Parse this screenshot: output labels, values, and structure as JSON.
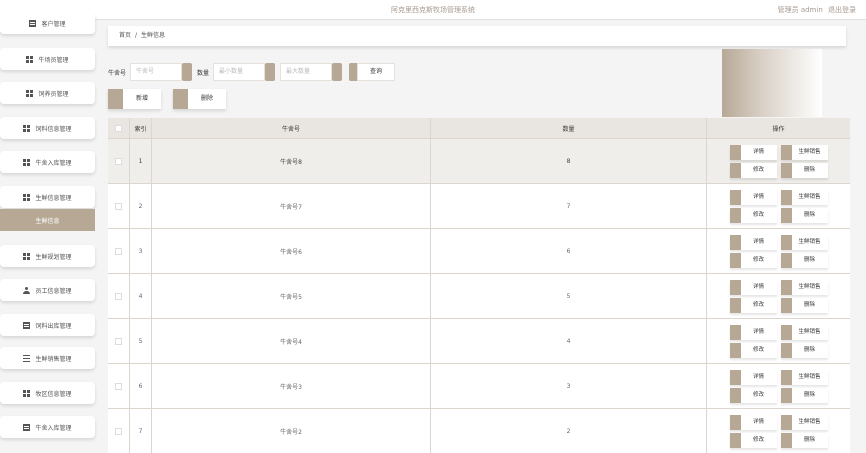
{
  "header": {
    "title": "阿克里西克斯牧场管理系统",
    "user_label": "管理员 admin",
    "logout_label": "退出登录"
  },
  "sidebar": {
    "items": [
      {
        "label": "客户管理",
        "icon": "doc-icon"
      },
      {
        "label": "牛场员管理",
        "icon": "grid-icon"
      },
      {
        "label": "饲养员管理",
        "icon": "grid-icon"
      },
      {
        "label": "饲料信息管理",
        "icon": "grid-icon"
      },
      {
        "label": "牛舍入库管理",
        "icon": "grid-icon"
      },
      {
        "label": "生鲜信息管理",
        "icon": "grid-icon"
      },
      {
        "label": "生鲜信息",
        "icon": "",
        "active": true
      },
      {
        "label": "生鲜规划管理",
        "icon": "grid-icon"
      },
      {
        "label": "员工信息管理",
        "icon": "user-icon"
      },
      {
        "label": "饲料出库管理",
        "icon": "doc-icon"
      },
      {
        "label": "生鲜销售管理",
        "icon": "tree-icon"
      },
      {
        "label": "牧区信息管理",
        "icon": "grid-icon"
      },
      {
        "label": "牛舍入库管理",
        "icon": "doc-icon"
      }
    ]
  },
  "breadcrumb": {
    "home": "首页",
    "separator": "/",
    "current": "生鲜信息"
  },
  "filters": {
    "name_label": "牛舍号",
    "name_placeholder": "牛舍号",
    "qty_label": "数量",
    "min_placeholder": "最小数量",
    "max_placeholder": "最大数量",
    "query_label": "查询"
  },
  "actions": {
    "add_label": "新增",
    "delete_label": "删除"
  },
  "table": {
    "headers": {
      "index": "索引",
      "name": "牛舍号",
      "qty": "数量",
      "ops": "操作"
    },
    "op_labels": {
      "detail": "详情",
      "sale": "生鲜销售",
      "edit": "修改",
      "delete": "删除"
    },
    "rows": [
      {
        "index": "1",
        "name": "牛舍号8",
        "qty": "8",
        "highlight": true
      },
      {
        "index": "2",
        "name": "牛舍号7",
        "qty": "7"
      },
      {
        "index": "3",
        "name": "牛舍号6",
        "qty": "6"
      },
      {
        "index": "4",
        "name": "牛舍号5",
        "qty": "5"
      },
      {
        "index": "5",
        "name": "牛舍号4",
        "qty": "4"
      },
      {
        "index": "6",
        "name": "牛舍号3",
        "qty": "3"
      },
      {
        "index": "7",
        "name": "牛舍号2",
        "qty": "2"
      }
    ]
  },
  "colors": {
    "accent": "#b7a896",
    "header_bg": "#e9e6e2"
  }
}
